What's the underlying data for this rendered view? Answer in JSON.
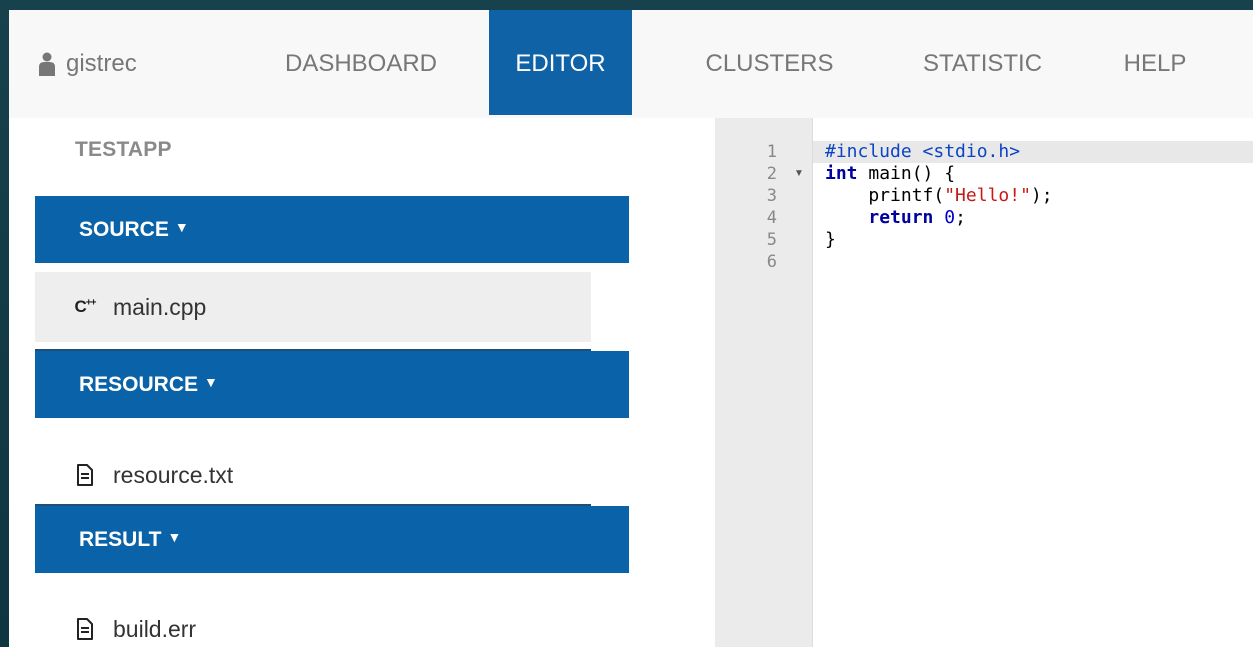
{
  "navbar": {
    "user": "gistrec",
    "items": [
      {
        "label": "DASHBOARD"
      },
      {
        "label": "EDITOR"
      },
      {
        "label": "CLUSTERS"
      },
      {
        "label": "STATISTIC"
      },
      {
        "label": "HELP"
      }
    ],
    "active": "EDITOR"
  },
  "sidebar": {
    "app_title": "TESTAPP",
    "sections": [
      {
        "title": "SOURCE",
        "files": [
          {
            "name": "main.cpp",
            "icon": "cpp-icon",
            "selected": true
          }
        ]
      },
      {
        "title": "RESOURCE",
        "files": [
          {
            "name": "resource.txt",
            "icon": "file-text-icon"
          }
        ]
      },
      {
        "title": "RESULT",
        "files": [
          {
            "name": "build.err",
            "icon": "file-text-icon"
          }
        ]
      }
    ]
  },
  "editor": {
    "line_numbers": [
      "1",
      "2",
      "3",
      "4",
      "5",
      "6"
    ],
    "code": {
      "line1": "#include <stdio.h>",
      "line2_kw": "int",
      "line2_rest": " main() {",
      "line3_pre": "    printf(",
      "line3_str": "\"Hello!\"",
      "line3_post": ");",
      "line4_pre": "    ",
      "line4_kw": "return",
      "line4_sp": " ",
      "line4_num": "0",
      "line4_post": ";",
      "line5": "}",
      "line6": ""
    }
  },
  "colors": {
    "accent": "#0a63a8",
    "background": "#17414c",
    "navbar": "#f8f8f8"
  }
}
